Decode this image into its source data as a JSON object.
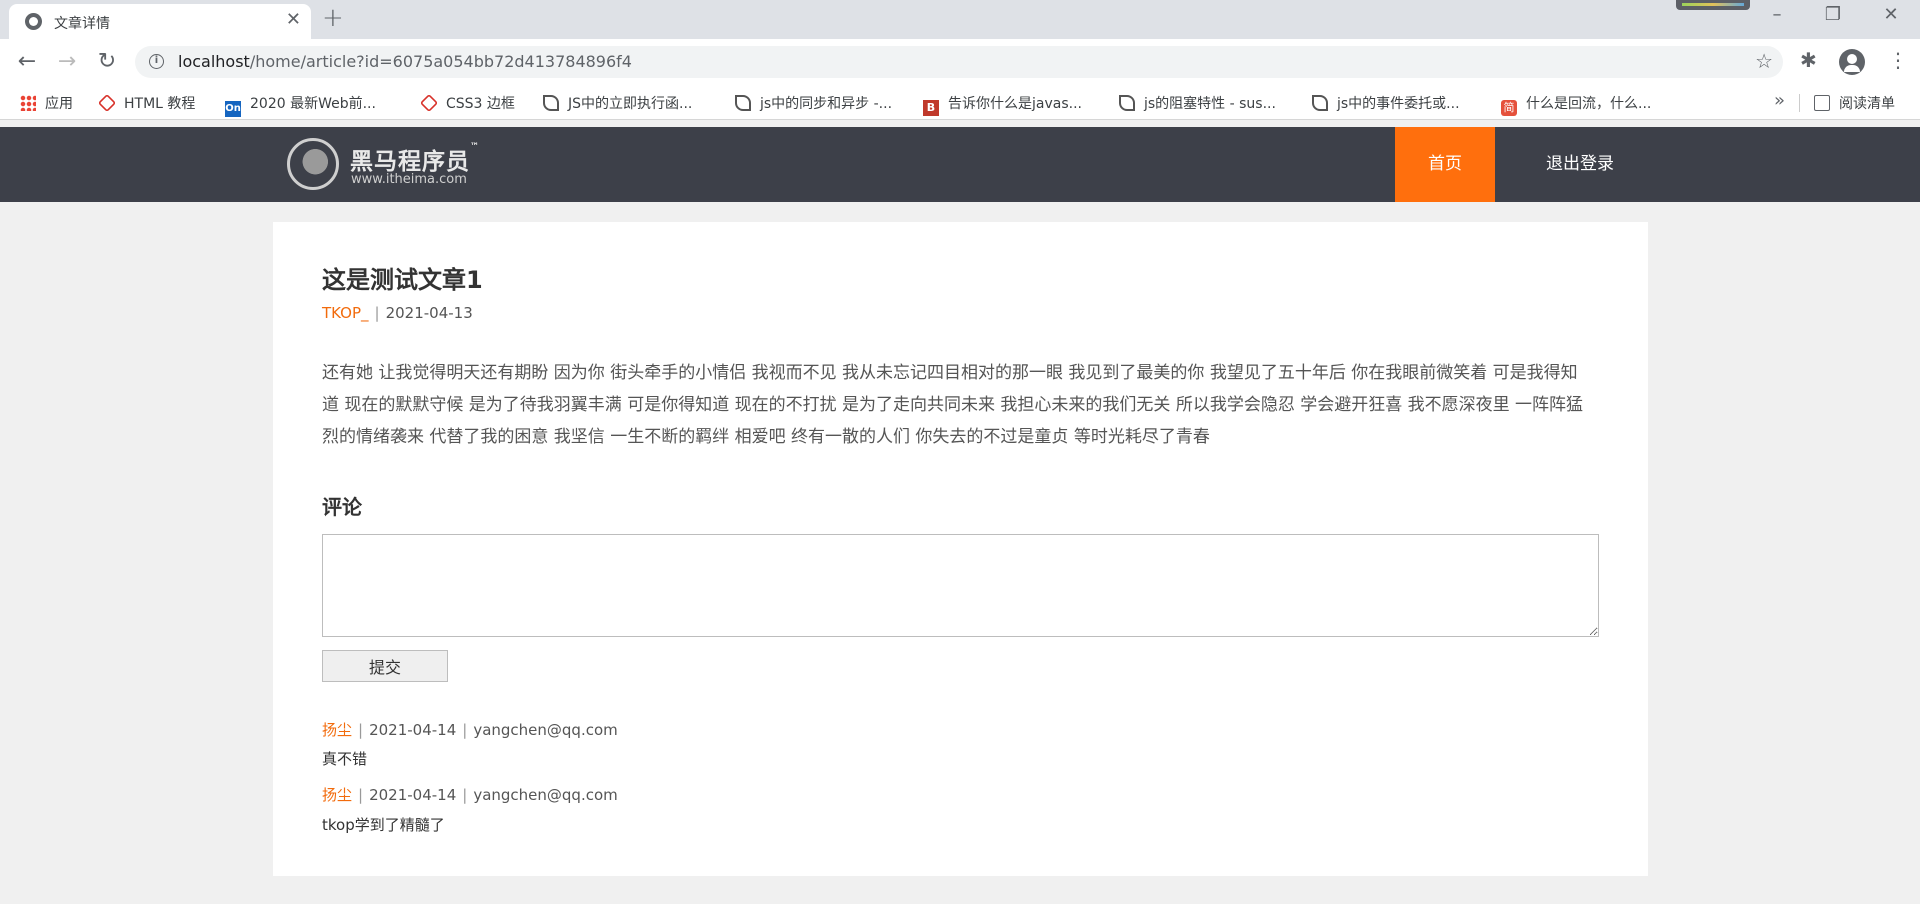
{
  "browser": {
    "tab_title": "文章详情",
    "url_host": "localhost",
    "url_path": "/home/article?id=6075a054bb72d413784896f4"
  },
  "bookmarks": {
    "items": [
      {
        "label": "应用",
        "icon": "apps-grid-icon"
      },
      {
        "label": "HTML 教程",
        "icon": "runoob-icon"
      },
      {
        "label": "2020 最新Web前...",
        "icon": "on-icon"
      },
      {
        "label": "CSS3 边框",
        "icon": "runoob-icon"
      },
      {
        "label": "JS中的立即执行函...",
        "icon": "csdn-icon"
      },
      {
        "label": "js中的同步和异步 -...",
        "icon": "csdn-icon"
      },
      {
        "label": "告诉你什么是javas...",
        "icon": "b-icon"
      },
      {
        "label": "js的阻塞特性 - sus...",
        "icon": "csdn-icon"
      },
      {
        "label": "js中的事件委托或...",
        "icon": "csdn-icon"
      },
      {
        "label": "什么是回流，什么...",
        "icon": "jianshu-icon"
      }
    ],
    "more": "»",
    "reading_list": "阅读清单"
  },
  "site": {
    "logo_name": "黑马程序员",
    "logo_tm": "™",
    "logo_url": "www.itheima.com",
    "nav": {
      "home": "首页",
      "logout": "退出登录"
    },
    "accent": "#ff6f0d",
    "header_bg": "#3d4049"
  },
  "article": {
    "title": "这是测试文章1",
    "author": "TKOP_",
    "date": "2021-04-13",
    "content": "还有她 让我觉得明天还有期盼 因为你 街头牵手的小情侣 我视而不见 我从未忘记四目相对的那一眼 我见到了最美的你 我望见了五十年后 你在我眼前微笑着 可是我得知道 现在的默默守候 是为了待我羽翼丰满 可是你得知道 现在的不打扰 是为了走向共同未来 我担心未来的我们无关 所以我学会隐忍 学会避开狂喜 我不愿深夜里 一阵阵猛烈的情绪袭来 代替了我的困意 我坚信 一生不断的羁绊 相爱吧 终有一散的人们 你失去的不过是童贞 等时光耗尽了青春"
  },
  "comments": {
    "heading": "评论",
    "textarea_value": "",
    "submit_label": "提交",
    "list": [
      {
        "user": "扬尘",
        "date": "2021-04-14",
        "email": "yangchen@qq.com",
        "body": "真不错"
      },
      {
        "user": "扬尘",
        "date": "2021-04-14",
        "email": "yangchen@qq.com",
        "body": "tkop学到了精髓了"
      }
    ]
  }
}
